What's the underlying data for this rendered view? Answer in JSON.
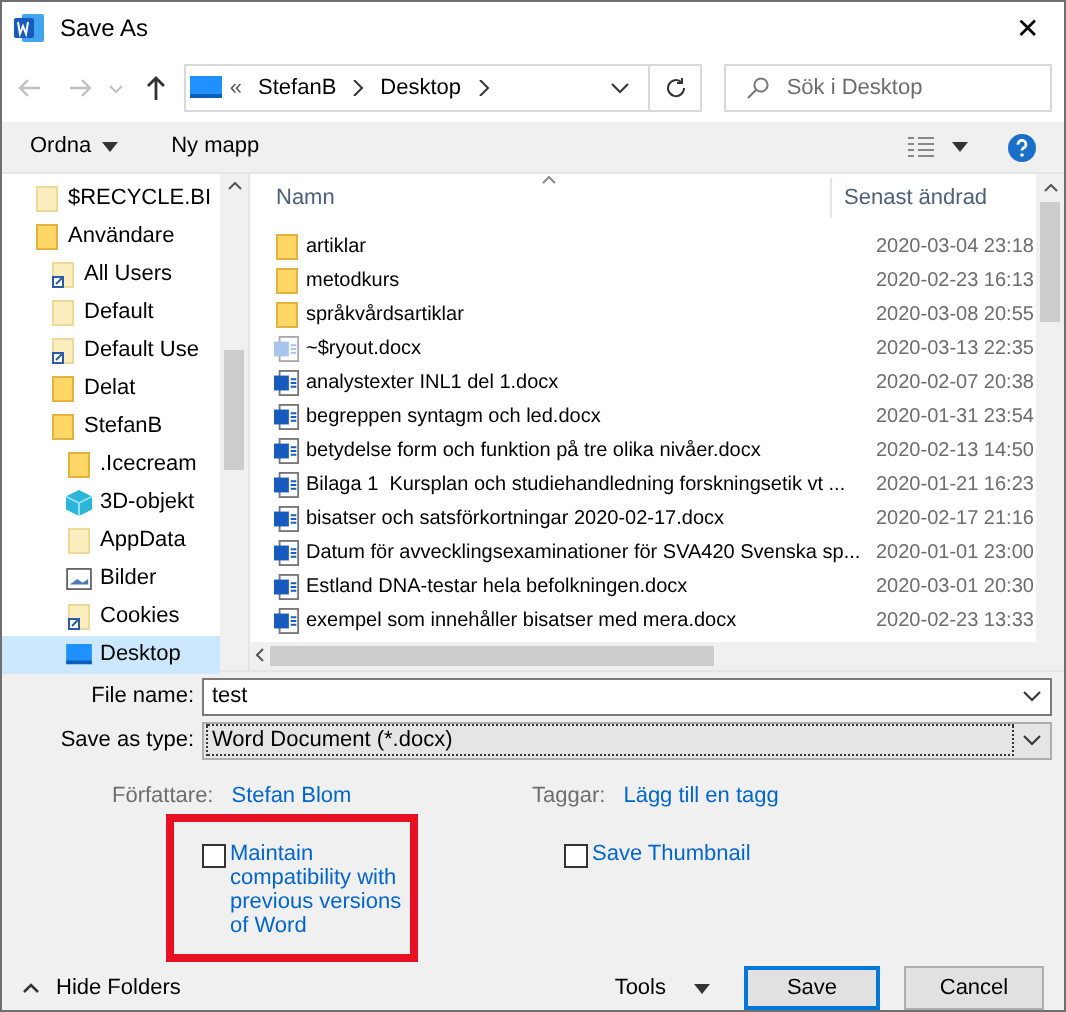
{
  "window": {
    "title": "Save As",
    "close": "✕"
  },
  "nav": {
    "path": [
      "StefanB",
      "Desktop"
    ],
    "prefix": "«",
    "search": {
      "placeholder": "Sök i Desktop"
    }
  },
  "toolbar": {
    "organize": "Ordna",
    "new_folder": "Ny mapp"
  },
  "sidebar": {
    "items": [
      {
        "label": "$RECYCLE.BI",
        "kind": "folder-light",
        "selected": false
      },
      {
        "label": "Användare",
        "kind": "folder",
        "selected": false,
        "children": [
          {
            "label": "All Users",
            "kind": "shortcut",
            "selected": false
          },
          {
            "label": "Default",
            "kind": "folder-light",
            "selected": false
          },
          {
            "label": "Default Use",
            "kind": "shortcut",
            "selected": false
          },
          {
            "label": "Delat",
            "kind": "folder",
            "selected": false
          },
          {
            "label": "StefanB",
            "kind": "folder",
            "selected": false,
            "children": [
              {
                "label": ".Icecream",
                "kind": "folder",
                "selected": false
              },
              {
                "label": "3D-objekt",
                "kind": "cube",
                "selected": false
              },
              {
                "label": "AppData",
                "kind": "folder-light",
                "selected": false
              },
              {
                "label": "Bilder",
                "kind": "pictures",
                "selected": false
              },
              {
                "label": "Cookies",
                "kind": "shortcut",
                "selected": false
              },
              {
                "label": "Desktop",
                "kind": "desktop",
                "selected": true
              }
            ]
          }
        ]
      }
    ]
  },
  "files": {
    "columns": [
      "Namn",
      "Senast ändrad"
    ],
    "rows": [
      {
        "name": "artiklar",
        "modified": "2020-03-04 23:18",
        "kind": "folder"
      },
      {
        "name": "metodkurs",
        "modified": "2020-02-23 16:13",
        "kind": "folder"
      },
      {
        "name": "språkvårdsartiklar",
        "modified": "2020-03-08 20:55",
        "kind": "folder"
      },
      {
        "name": "~$ryout.docx",
        "modified": "2020-03-13 22:35",
        "kind": "temp"
      },
      {
        "name": "analystexter INL1 del 1.docx",
        "modified": "2020-02-07 20:38",
        "kind": "doc"
      },
      {
        "name": "begreppen syntagm och led.docx",
        "modified": "2020-01-31 23:54",
        "kind": "doc"
      },
      {
        "name": "betydelse form och funktion på tre olika nivåer.docx",
        "modified": "2020-02-13 14:50",
        "kind": "doc"
      },
      {
        "name": "Bilaga 1  Kursplan och studiehandledning forskningsetik vt ...",
        "modified": "2020-01-21 16:23",
        "kind": "doc"
      },
      {
        "name": "bisatser och satsförkortningar 2020-02-17.docx",
        "modified": "2020-02-17 21:16",
        "kind": "doc"
      },
      {
        "name": "Datum för avvecklingsexaminationer för SVA420 Svenska sp...",
        "modified": "2020-01-01 23:00",
        "kind": "doc"
      },
      {
        "name": "Estland DNA-testar hela befolkningen.docx",
        "modified": "2020-03-01 20:30",
        "kind": "doc"
      },
      {
        "name": "exempel som innehåller bisatser med mera.docx",
        "modified": "2020-02-23 13:33",
        "kind": "doc"
      }
    ]
  },
  "form": {
    "file_name": {
      "label": "File name:",
      "value": "test"
    },
    "save_type": {
      "label": "Save as type:",
      "value": "Word Document (*.docx)"
    }
  },
  "meta": [
    {
      "label": "Författare:",
      "value": "Stefan Blom"
    },
    {
      "label": "Taggar:",
      "value": "Lägg till en tagg"
    }
  ],
  "options": [
    {
      "label": "Maintain compatibility with previous versions of Word",
      "checked": false,
      "highlighted": true
    },
    {
      "label": "Save Thumbnail",
      "checked": false,
      "highlighted": false
    }
  ],
  "footer": {
    "hide_folders": "Hide Folders",
    "tools": "Tools",
    "save": "Save",
    "cancel": "Cancel"
  }
}
